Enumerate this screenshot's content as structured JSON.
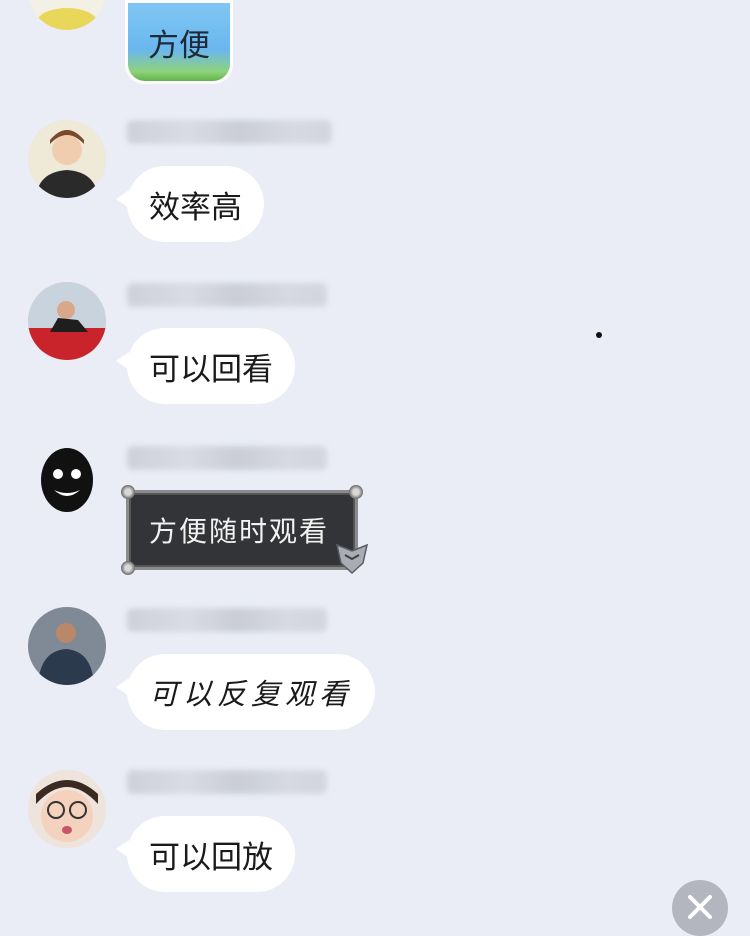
{
  "messages": [
    {
      "text": "方便",
      "style": "blue-sticker"
    },
    {
      "text": "效率高",
      "style": "plain"
    },
    {
      "text": "可以回看",
      "style": "plain"
    },
    {
      "text": "方便随时观看",
      "style": "dark-frame"
    },
    {
      "text": "可以反复观看",
      "style": "handwritten"
    },
    {
      "text": "可以回放",
      "style": "plain"
    }
  ],
  "icons": {
    "close": "close-icon"
  },
  "colors": {
    "background": "#eaedf5",
    "bubble": "#ffffff",
    "dark_bubble": "#333437"
  }
}
